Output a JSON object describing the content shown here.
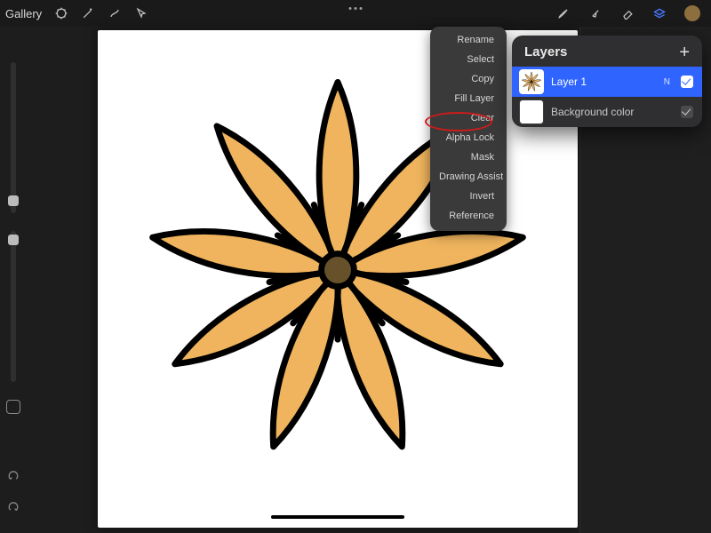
{
  "topbar": {
    "gallery_label": "Gallery",
    "icons": {
      "wrench": "adjustments-icon",
      "wand": "selection-wand-icon",
      "s_shape": "transform-icon",
      "cursor": "move-icon",
      "brush": "brush-icon",
      "smudge": "smudge-icon",
      "eraser": "eraser-icon",
      "layers": "layers-icon",
      "color": "color-swatch"
    },
    "accent_color": "#4a79ff",
    "swatch_color": "#8d6f3e"
  },
  "left_rail": {
    "brush_size_pct": 90,
    "opacity_pct": 4
  },
  "context_menu": {
    "items": [
      "Rename",
      "Select",
      "Copy",
      "Fill Layer",
      "Clear",
      "Alpha Lock",
      "Mask",
      "Drawing Assist",
      "Invert",
      "Reference"
    ],
    "highlighted_item": "Alpha Lock"
  },
  "layers_panel": {
    "title": "Layers",
    "add_label": "+",
    "rows": [
      {
        "name": "Layer 1",
        "blend": "N",
        "checked": true,
        "selected": true,
        "thumb": "flower"
      },
      {
        "name": "Background color",
        "blend": "",
        "checked": true,
        "selected": false,
        "thumb": "white"
      }
    ]
  },
  "canvas": {
    "artwork": "flower",
    "petal_fill": "#efb45d",
    "petal_stroke": "#000000",
    "center_fill": "#66512a"
  }
}
